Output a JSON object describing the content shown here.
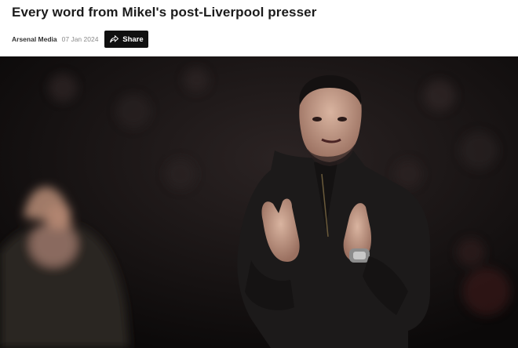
{
  "article": {
    "title": "Every word from Mikel's post-Liverpool presser",
    "author": "Arsenal Media",
    "date": "07 Jan 2024",
    "share_label": "Share"
  },
  "hero_image": {
    "alt": "Mikel Arteta applauding on the touchline at night"
  }
}
